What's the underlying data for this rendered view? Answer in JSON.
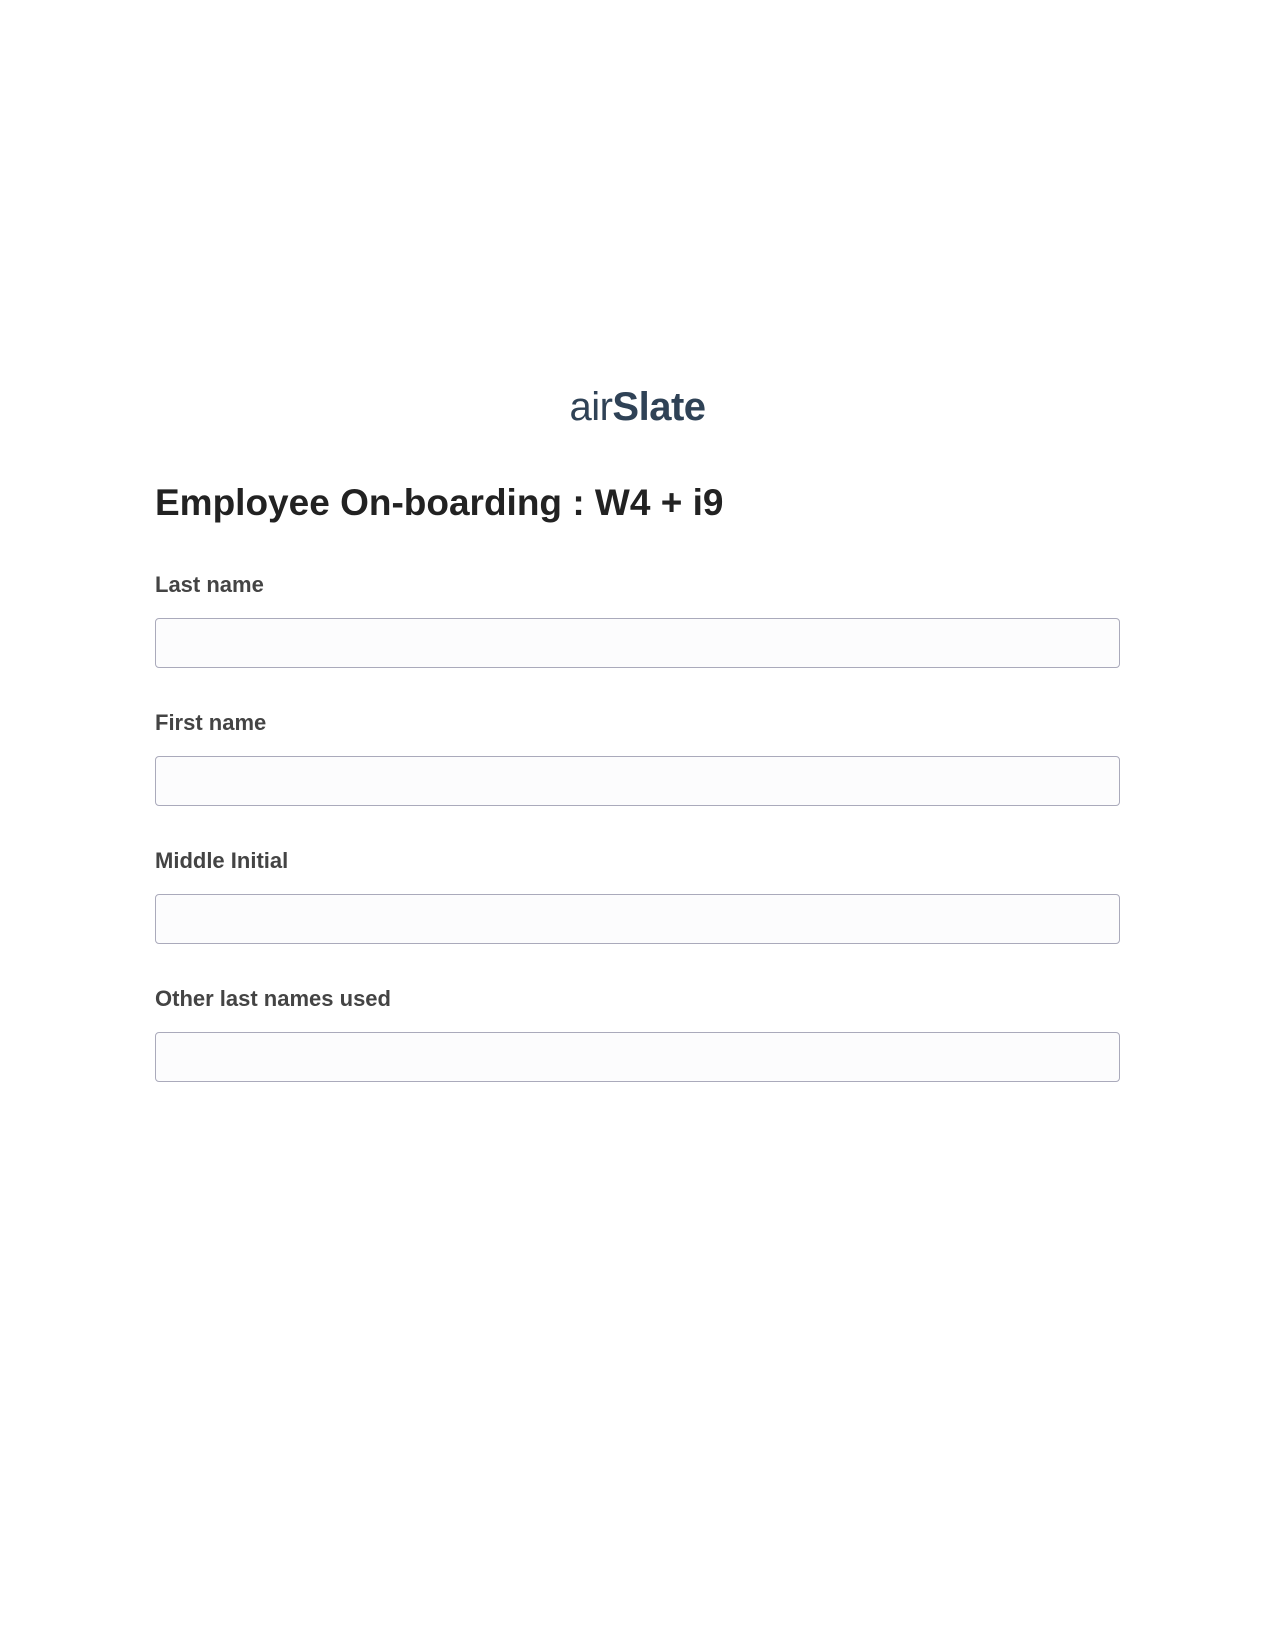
{
  "brand": {
    "name_prefix": "air",
    "name_suffix": "Slate"
  },
  "form": {
    "title": "Employee On-boarding : W4 + i9",
    "fields": [
      {
        "label": "Last name",
        "value": ""
      },
      {
        "label": "First name",
        "value": ""
      },
      {
        "label": "Middle Initial",
        "value": ""
      },
      {
        "label": "Other last names used",
        "value": ""
      }
    ]
  }
}
